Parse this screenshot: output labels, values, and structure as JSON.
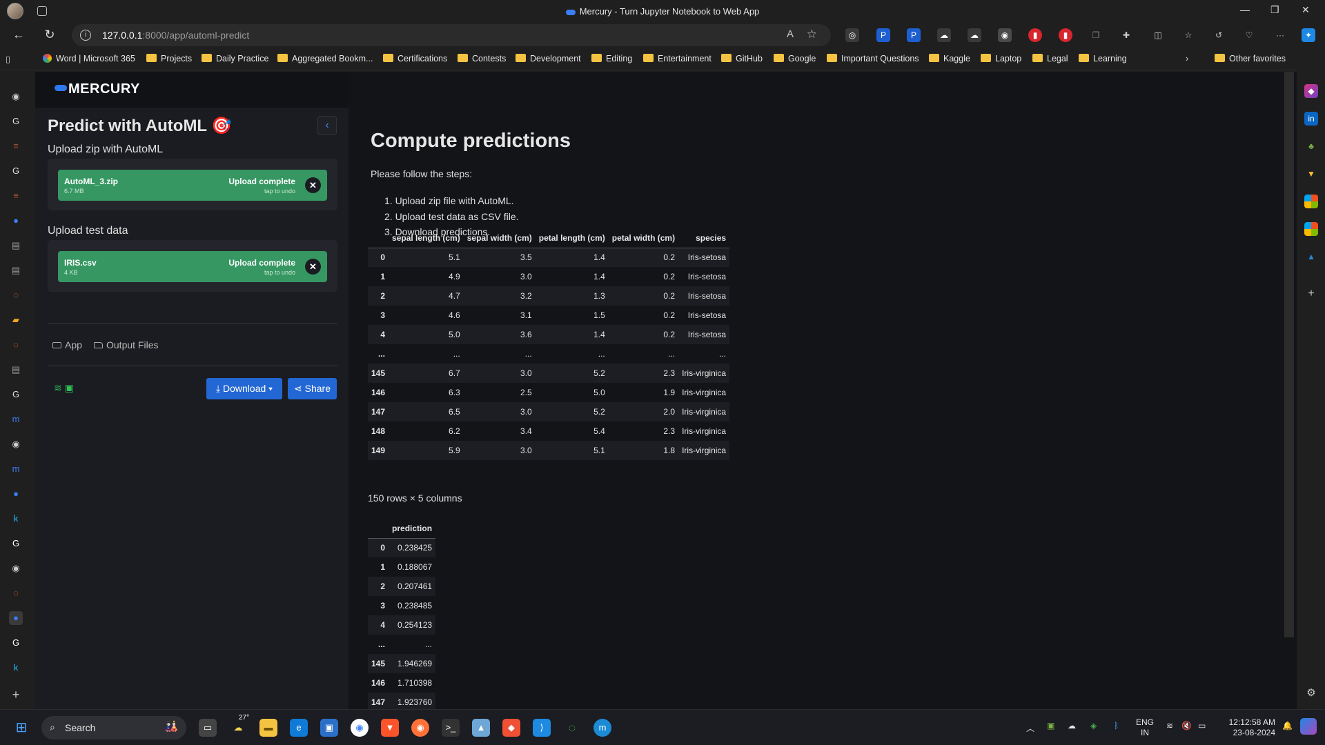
{
  "window": {
    "title": "Mercury - Turn Jupyter Notebook to Web App"
  },
  "address": {
    "host": "127.0.0.1",
    "rest": ":8000/app/automl-predict"
  },
  "bookmarks": [
    "Word | Microsoft 365",
    "Projects",
    "Daily Practice",
    "Aggregated Bookm...",
    "Certifications",
    "Contests",
    "Development",
    "Editing",
    "Entertainment",
    "GitHub",
    "Google",
    "Important Questions",
    "Kaggle",
    "Laptop",
    "Legal",
    "Learning"
  ],
  "bookmarks_other": "Other favorites",
  "app": {
    "brand": "MERCURY",
    "sidebar_title": "Predict with AutoML 🎯",
    "upload1": {
      "label": "Upload zip with AutoML",
      "file": "AutoML_3.zip",
      "size": "6.7 MB",
      "status": "Upload complete",
      "undo": "tap to undo"
    },
    "upload2": {
      "label": "Upload test data",
      "file": "IRIS.csv",
      "size": "4 KB",
      "status": "Upload complete",
      "undo": "tap to undo"
    },
    "nav": {
      "app": "App",
      "output": "Output Files"
    },
    "download": "Download",
    "share": "Share"
  },
  "main": {
    "heading": "Compute predictions",
    "intro": "Please follow the steps:",
    "steps": [
      "1. Upload zip file with AutoML.",
      "2. Upload test data as CSV file.",
      "3. Download predictions."
    ],
    "table1": {
      "columns": [
        "",
        "sepal length (cm)",
        "sepal width (cm)",
        "petal length (cm)",
        "petal width (cm)",
        "species"
      ],
      "rows": [
        [
          "0",
          "5.1",
          "3.5",
          "1.4",
          "0.2",
          "Iris-setosa"
        ],
        [
          "1",
          "4.9",
          "3.0",
          "1.4",
          "0.2",
          "Iris-setosa"
        ],
        [
          "2",
          "4.7",
          "3.2",
          "1.3",
          "0.2",
          "Iris-setosa"
        ],
        [
          "3",
          "4.6",
          "3.1",
          "1.5",
          "0.2",
          "Iris-setosa"
        ],
        [
          "4",
          "5.0",
          "3.6",
          "1.4",
          "0.2",
          "Iris-setosa"
        ],
        [
          "...",
          "...",
          "...",
          "...",
          "...",
          "..."
        ],
        [
          "145",
          "6.7",
          "3.0",
          "5.2",
          "2.3",
          "Iris-virginica"
        ],
        [
          "146",
          "6.3",
          "2.5",
          "5.0",
          "1.9",
          "Iris-virginica"
        ],
        [
          "147",
          "6.5",
          "3.0",
          "5.2",
          "2.0",
          "Iris-virginica"
        ],
        [
          "148",
          "6.2",
          "3.4",
          "5.4",
          "2.3",
          "Iris-virginica"
        ],
        [
          "149",
          "5.9",
          "3.0",
          "5.1",
          "1.8",
          "Iris-virginica"
        ]
      ]
    },
    "summary": "150 rows × 5 columns",
    "table2": {
      "columns": [
        "",
        "prediction"
      ],
      "rows": [
        [
          "0",
          "0.238425"
        ],
        [
          "1",
          "0.188067"
        ],
        [
          "2",
          "0.207461"
        ],
        [
          "3",
          "0.238485"
        ],
        [
          "4",
          "0.254123"
        ],
        [
          "...",
          "..."
        ],
        [
          "145",
          "1.946269"
        ],
        [
          "146",
          "1.710398"
        ],
        [
          "147",
          "1.923760"
        ]
      ]
    }
  },
  "taskbar": {
    "search": "Search",
    "weather": "27°",
    "lang1": "ENG",
    "lang2": "IN",
    "time": "12:12:58 AM",
    "date": "23-08-2024"
  }
}
